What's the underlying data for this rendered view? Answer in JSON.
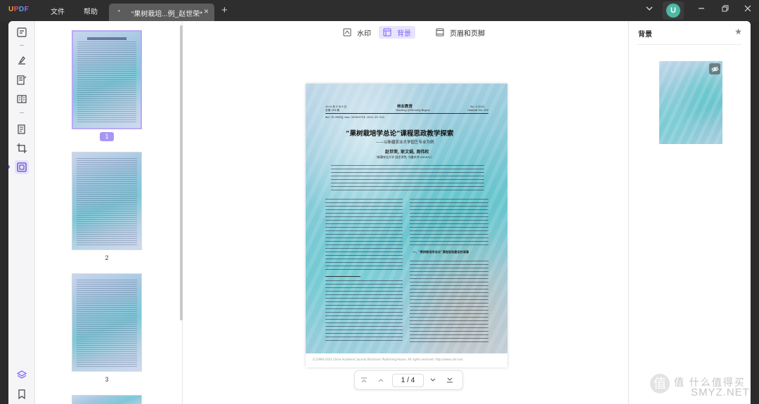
{
  "app": {
    "logo": "UPDF",
    "menu": [
      "文件",
      "帮助"
    ],
    "tab_title": "“果树栽培...例_赵世荣*",
    "tab_dot": "•",
    "avatar_letter": "U"
  },
  "toolbar": {
    "watermark": "水印",
    "background": "背景",
    "header_footer": "页眉和页脚",
    "active": "背景"
  },
  "thumbnails": {
    "pages": [
      "1",
      "2",
      "3"
    ],
    "selected": "1"
  },
  "document": {
    "journal_left": [
      "2023 年 9 月 8 日",
      "总第 318 期"
    ],
    "journal_name": "林业教育",
    "journal_en": "Teaching of Forestry Region",
    "journal_right": [
      "No. 9  2023",
      "General No. 318"
    ],
    "doi": "doi: 10.3969/j. issn. 1008-6714. 2023. 09. 020",
    "title": "“果树栽培学总论”课程思政教学探索",
    "subtitle": "——以新疆农业大学园艺专业为例",
    "authors": "赵世荣, 耿文娟, 周伟权",
    "affiliation": "（新疆农业大学 园艺学院, 乌鲁木齐 830052）",
    "section_heading": "一、“果树栽培学总论”课程思政建设的背景",
    "footer": "(C)1994-2023 China Academic Journal Electronic Publishing House. All rights reserved.    http://www.cnki.net"
  },
  "pagination": {
    "current": "1",
    "total": "4",
    "display": "1  /  4"
  },
  "right_panel": {
    "title": "背景"
  },
  "watermark_overlay": {
    "line1": "值 什么值得买",
    "line2": "SMYZ.NET"
  },
  "colors": {
    "accent": "#7b61ff",
    "titlebar": "#2e2e2e",
    "active_bg": "#e9e4fd"
  }
}
